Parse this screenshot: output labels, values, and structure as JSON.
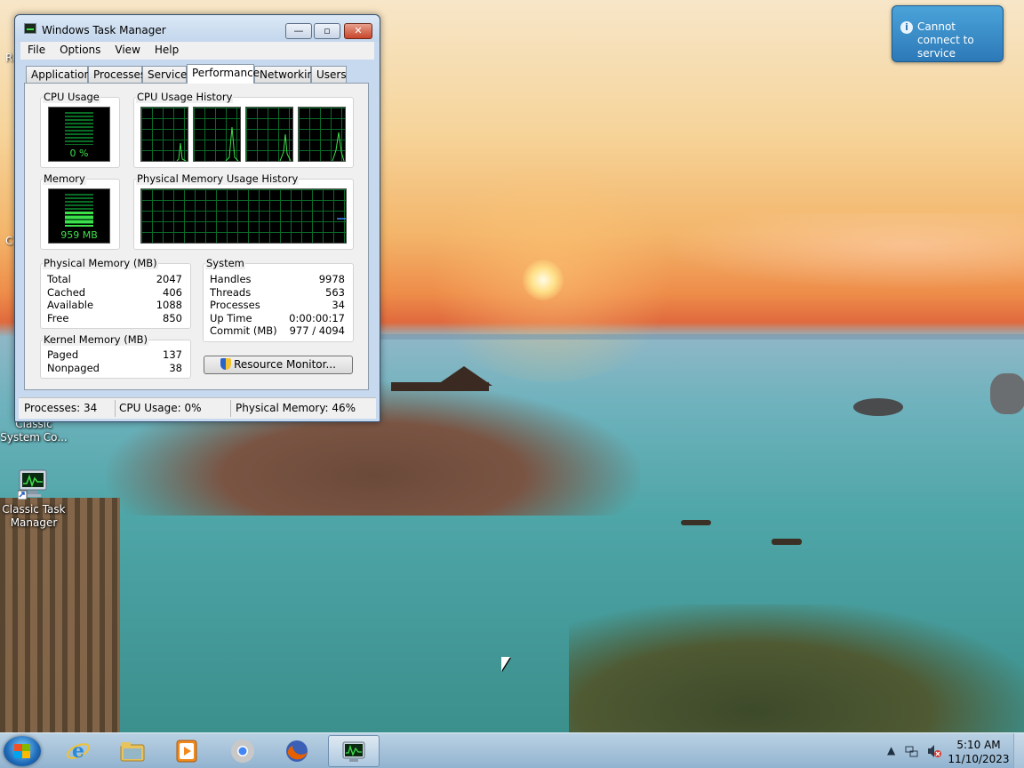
{
  "window": {
    "title": "Windows Task Manager",
    "minimize": "—",
    "maximize": "▫",
    "close": "✕"
  },
  "menu": [
    "File",
    "Options",
    "View",
    "Help"
  ],
  "tabs": [
    "Applications",
    "Processes",
    "Services",
    "Performance",
    "Networking",
    "Users"
  ],
  "active_tab": "Performance",
  "performance": {
    "cpu_usage_label": "CPU Usage",
    "cpu_usage_value": "0 %",
    "cpu_usage_level": 0,
    "cpu_history_label": "CPU Usage History",
    "memory_label": "Memory",
    "memory_value": "959 MB",
    "memory_level": 0.46,
    "memory_history_label": "Physical Memory Usage History",
    "physical_memory": {
      "label": "Physical Memory (MB)",
      "rows": [
        {
          "key": "Total",
          "value": "2047"
        },
        {
          "key": "Cached",
          "value": "406"
        },
        {
          "key": "Available",
          "value": "1088"
        },
        {
          "key": "Free",
          "value": "850"
        }
      ]
    },
    "kernel_memory": {
      "label": "Kernel Memory (MB)",
      "rows": [
        {
          "key": "Paged",
          "value": "137"
        },
        {
          "key": "Nonpaged",
          "value": "38"
        }
      ]
    },
    "system": {
      "label": "System",
      "rows": [
        {
          "key": "Handles",
          "value": "9978"
        },
        {
          "key": "Threads",
          "value": "563"
        },
        {
          "key": "Processes",
          "value": "34"
        },
        {
          "key": "Up Time",
          "value": "0:00:00:17"
        },
        {
          "key": "Commit (MB)",
          "value": "977 / 4094"
        }
      ]
    },
    "resource_monitor_button": "Resource Monitor..."
  },
  "status_bar": {
    "processes": "Processes: 34",
    "cpu": "CPU Usage: 0%",
    "memory": "Physical Memory: 46%"
  },
  "notification": {
    "text": "Cannot connect to service",
    "icon": "info-icon"
  },
  "desktop_icons": [
    {
      "label": "Classic System Co...",
      "icon": "control-panel-icon"
    },
    {
      "label": "Classic Task Manager",
      "icon": "task-manager-icon"
    }
  ],
  "desktop_edge_text": [
    "R",
    "C"
  ],
  "taskbar": {
    "items": [
      {
        "name": "internet-explorer",
        "icon": "ie-icon",
        "color": "#2a8ad8"
      },
      {
        "name": "file-explorer",
        "icon": "folder-icon",
        "color": "#e8c25a"
      },
      {
        "name": "media-player",
        "icon": "media-player-icon",
        "color": "#f08a1c"
      },
      {
        "name": "chrome",
        "icon": "chrome-icon",
        "color": "#4285f4"
      },
      {
        "name": "firefox",
        "icon": "firefox-icon",
        "color": "#e66000"
      },
      {
        "name": "task-manager",
        "icon": "task-manager-icon",
        "color": "#3a4a3a"
      }
    ],
    "clock_time": "5:10 AM",
    "clock_date": "11/10/2023"
  }
}
